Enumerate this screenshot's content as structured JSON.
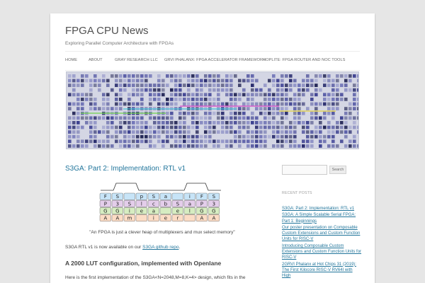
{
  "site": {
    "title": "FPGA CPU News",
    "description": "Exploring Parallel Computer Architecture with FPGAs"
  },
  "nav": {
    "items": [
      "HOME",
      "ABOUT",
      "GRAY RESEARCH LLC",
      "GRVI PHALANX: FPGA ACCELERATOR FRAMEWORK",
      "HOPLITE: FPGA ROUTER AND NOC TOOLS"
    ]
  },
  "post": {
    "title": "S3GA: Part 2: Implementation: RTL v1",
    "caption": "\"An FPGA is just a clever heap of multiplexers and mux select memory\"",
    "para_prefix": "S3GA RTL v1 is now available on our ",
    "para_link": "S3GA github repo",
    "para_suffix": ".",
    "heading": "A 2000 LUT configuration, implemented with Openlane",
    "para2": "Here is the first implementation of the S3GA<N=2048,M=8,K=4> design, which fits in the"
  },
  "figure": {
    "rows": [
      [
        "F",
        "S",
        "",
        "p",
        "S",
        "a",
        "",
        "i",
        "F",
        "S"
      ],
      [
        "P",
        "3",
        "S",
        "l",
        "c",
        "b",
        "S",
        "a",
        "P",
        "3"
      ],
      [
        "G",
        "G",
        "i",
        "e",
        "a",
        "",
        "e",
        "l",
        "G",
        "G"
      ],
      [
        "A",
        "A",
        "m",
        "",
        "i",
        "e",
        "r",
        "",
        "A",
        "A"
      ]
    ],
    "colors": {
      "row1": "#c7e4f7",
      "row2": "#e3cdea",
      "row3": "#d6ecc1",
      "row4": "#fbdcc5"
    }
  },
  "sidebar": {
    "search_placeholder": "",
    "search_button": "Search",
    "recent_title": "RECENT POSTS",
    "recent_posts": [
      "S3GA: Part 2: Implementation: RTL v1",
      "S3GA: A Simple Scalable Serial FPGA: Part 1: Beginnings",
      "Our poster presentation on Composable Custom Extensions and Custom Function Units for RISC-V",
      "Introducing Composable Custom Extensions and Custom Function Units for RISC-V",
      "2GRVI Phalanx at Hot Chips 31 (2019): The First Kilocore RISC-V RV64I with High"
    ]
  },
  "colors": {
    "link": "#21759b",
    "text": "#444444",
    "background": "#e6e6e6"
  }
}
